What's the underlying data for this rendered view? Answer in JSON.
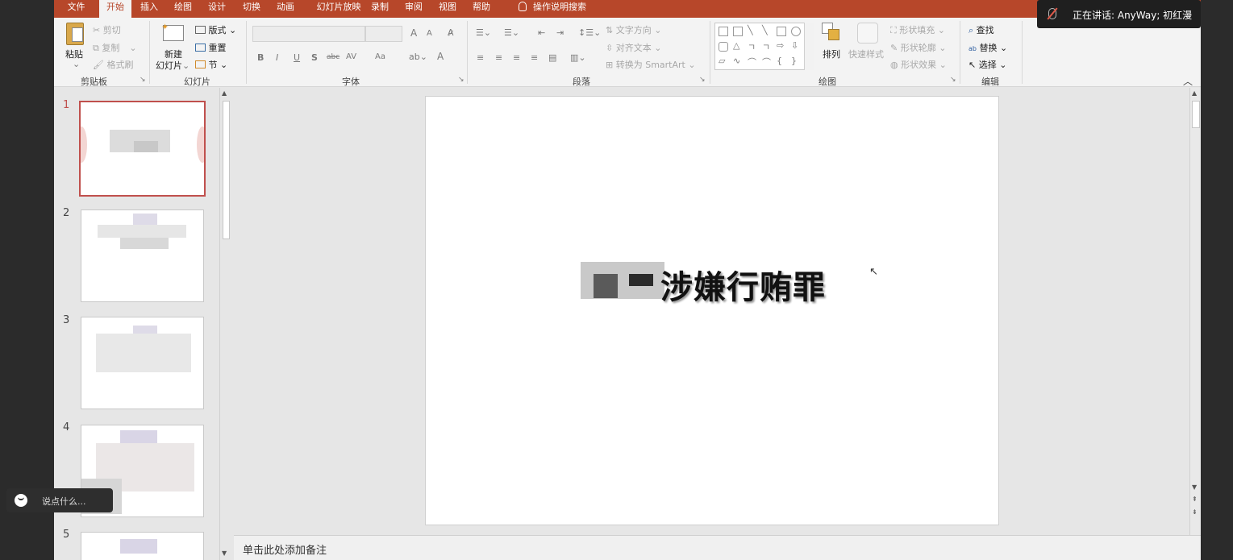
{
  "tabs": [
    "文件",
    "开始",
    "插入",
    "绘图",
    "设计",
    "切换",
    "动画",
    "幻灯片放映",
    "录制",
    "审阅",
    "视图",
    "帮助"
  ],
  "active_tab": "开始",
  "tell_me": "操作说明搜索",
  "ribbon": {
    "clipboard": {
      "paste": "粘贴",
      "cut": "剪切",
      "copy": "复制",
      "format_painter": "格式刷",
      "label": "剪贴板"
    },
    "slides": {
      "new_slide_1": "新建",
      "new_slide_2": "幻灯片",
      "layout": "版式",
      "reset": "重置",
      "section": "节",
      "label": "幻灯片"
    },
    "font": {
      "bold": "B",
      "italic": "I",
      "underline": "U",
      "shadow": "S",
      "strike": "abc",
      "spacing": "AV",
      "case": "Aa",
      "color": "A",
      "grow": "A",
      "shrink": "A",
      "label": "字体"
    },
    "paragraph": {
      "text_direction": "文字方向",
      "align_text": "对齐文本",
      "smartart": "转换为 SmartArt",
      "label": "段落"
    },
    "drawing": {
      "arrange": "排列",
      "quick_styles": "快速样式",
      "shape_fill": "形状填充",
      "shape_outline": "形状轮廓",
      "shape_effects": "形状效果",
      "label": "绘图"
    },
    "editing": {
      "find": "查找",
      "replace": "替换",
      "select": "选择",
      "label": "编辑"
    }
  },
  "slides": [
    {
      "num": "1"
    },
    {
      "num": "2"
    },
    {
      "num": "3"
    },
    {
      "num": "4"
    },
    {
      "num": "5"
    }
  ],
  "main_slide": {
    "title_visible": "涉嫌行贿罪"
  },
  "notes_placeholder": "单击此处添加备注",
  "speaking": "正在讲话: AnyWay; 初红漫",
  "chat_placeholder": "说点什么...",
  "colors": {
    "accent": "#b7472a",
    "selection": "#c0504d"
  }
}
